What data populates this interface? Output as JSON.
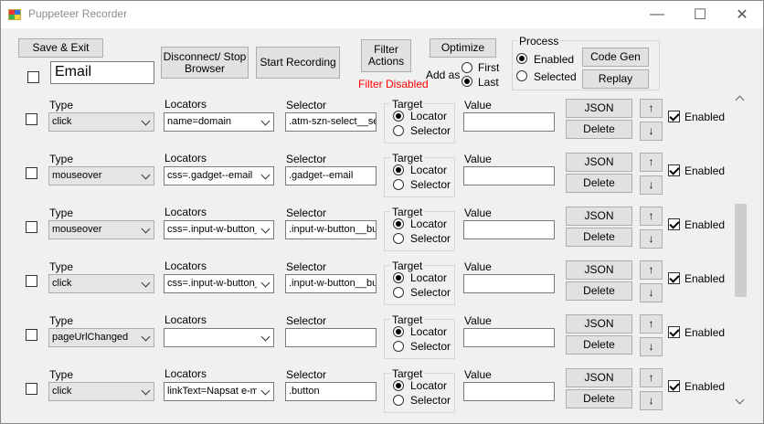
{
  "window": {
    "title": "Puppeteer Recorder",
    "minimize": "—",
    "maximize": "☐",
    "close": "✕"
  },
  "toolbar": {
    "save_exit": "Save & Exit",
    "disconnect": "Disconnect/ Stop Browser",
    "start_recording": "Start Recording",
    "filter_actions": "Filter Actions",
    "filter_status": "Filter Disabled",
    "filter_status_color": "#ff0000",
    "optimize": "Optimize",
    "add_as_label": "Add as",
    "add_as_first": "First",
    "add_as_last": "Last",
    "add_as_selected": "Last",
    "name_value": "Email"
  },
  "process": {
    "title": "Process",
    "enabled": "Enabled",
    "selected": "Selected",
    "checked": "Enabled",
    "code_gen": "Code Gen",
    "replay": "Replay"
  },
  "labels": {
    "type": "Type",
    "locators": "Locators",
    "selector": "Selector",
    "target": "Target",
    "locator": "Locator",
    "selector_opt": "Selector",
    "value": "Value",
    "json": "JSON",
    "delete": "Delete",
    "up": "↑",
    "down": "↓",
    "enabled": "Enabled"
  },
  "steps": [
    {
      "type": "click",
      "locator": "name=domain",
      "selector": ".atm-szn-select__se",
      "target": "Locator",
      "value": "",
      "enabled": true,
      "checked": false
    },
    {
      "type": "mouseover",
      "locator": "css=.gadget--email",
      "selector": ".gadget--email",
      "target": "Locator",
      "value": "",
      "enabled": true,
      "checked": false
    },
    {
      "type": "mouseover",
      "locator": "css=.input-w-button_",
      "selector": ".input-w-button__bu",
      "target": "Locator",
      "value": "",
      "enabled": true,
      "checked": false
    },
    {
      "type": "click",
      "locator": "css=.input-w-button_",
      "selector": ".input-w-button__bu",
      "target": "Locator",
      "value": "",
      "enabled": true,
      "checked": false
    },
    {
      "type": "pageUrlChanged",
      "locator": "",
      "selector": "",
      "target": "Locator",
      "value": "",
      "enabled": true,
      "checked": false
    },
    {
      "type": "click",
      "locator": "linkText=Napsat e-m",
      "selector": ".button",
      "target": "Locator",
      "value": "",
      "enabled": true,
      "checked": false
    }
  ]
}
